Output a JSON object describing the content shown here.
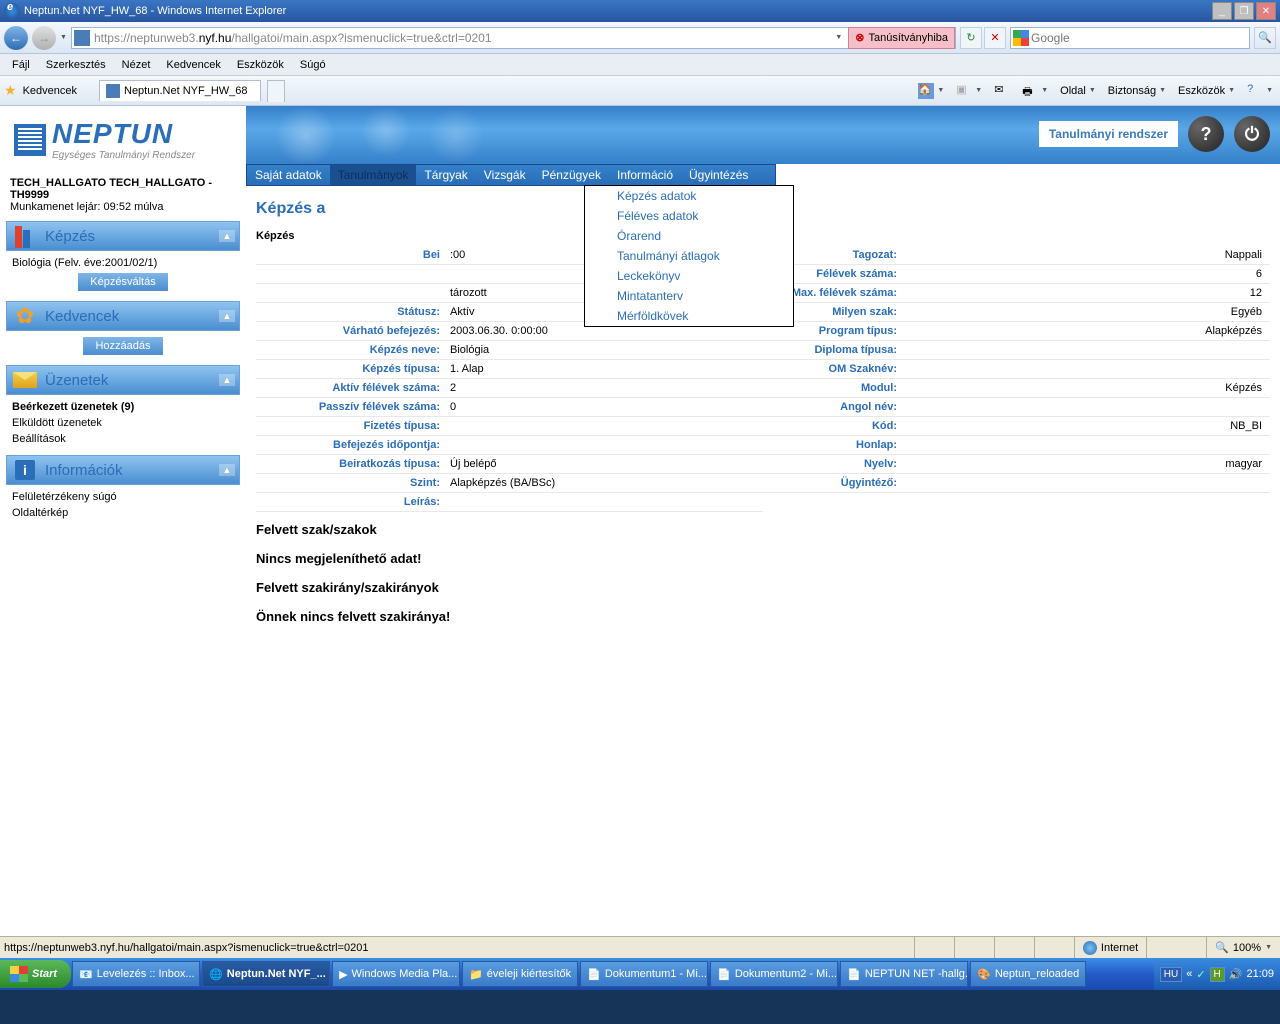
{
  "window": {
    "title": "Neptun.Net NYF_HW_68 - Windows Internet Explorer",
    "minimize": "_",
    "maximize": "❐",
    "close": "✕"
  },
  "nav": {
    "url_pre": "https://neptunweb3.",
    "url_green": "nyf.hu",
    "url_post": "/hallgatoi/main.aspx?ismenuclick=true&ctrl=0201",
    "cert_error": "Tanúsítványhiba",
    "search_placeholder": "Google"
  },
  "menu": [
    "Fájl",
    "Szerkesztés",
    "Nézet",
    "Kedvencek",
    "Eszközök",
    "Súgó"
  ],
  "favbar": {
    "label": "Kedvencek",
    "tab": "Neptun.Net NYF_HW_68",
    "tools": [
      "Oldal",
      "Biztonság",
      "Eszközök"
    ]
  },
  "brand": {
    "name": "NEPTUN",
    "sub": "Egységes Tanulmányi Rendszer"
  },
  "user": {
    "name": "TECH_HALLGATO TECH_HALLGATO - TH9999",
    "session": "Munkamenet lejár: 09:52 múlva"
  },
  "sidebar": {
    "training": {
      "title": "Képzés",
      "current": "Biológia (Felv. éve:2001/02/1)",
      "switch_btn": "Képzésváltás"
    },
    "favorites": {
      "title": "Kedvencek",
      "add_btn": "Hozzáadás"
    },
    "messages": {
      "title": "Üzenetek",
      "items": [
        "Beérkezett üzenetek (9)",
        "Elküldött üzenetek",
        "Beállítások"
      ]
    },
    "info": {
      "title": "Információk",
      "items": [
        "Felületérzékeny súgó",
        "Oldaltérkép"
      ]
    }
  },
  "header": {
    "system": "Tanulmányi rendszer",
    "help": "?",
    "power": "⏻"
  },
  "mainmenu": [
    "Saját adatok",
    "Tanulmányok",
    "Tárgyak",
    "Vizsgák",
    "Pénzügyek",
    "Információ",
    "Ügyintézés"
  ],
  "dropdown": [
    "Képzés adatok",
    "Féléves adatok",
    "Órarend",
    "Tanulmányi átlagok",
    "Leckekönyv",
    "Mintatanterv",
    "Mérföldkövek"
  ],
  "page": {
    "title": "Képzés a",
    "section": "Képzés"
  },
  "left_fields": [
    {
      "l": "Bei",
      "v": ":00"
    },
    {
      "l": "",
      "v": ""
    },
    {
      "l": "",
      "v": "tározott"
    },
    {
      "l": "Státusz:",
      "v": "Aktív"
    },
    {
      "l": "Várható befejezés:",
      "v": "2003.06.30. 0:00:00"
    },
    {
      "l": "Képzés neve:",
      "v": "Biológia"
    },
    {
      "l": "Képzés típusa:",
      "v": "1. Alap"
    },
    {
      "l": "Aktív félévek száma:",
      "v": "2"
    },
    {
      "l": "Passzív félévek száma:",
      "v": "0"
    },
    {
      "l": "Fizetés típusa:",
      "v": ""
    },
    {
      "l": "Befejezés időpontja:",
      "v": ""
    },
    {
      "l": "Beiratkozás típusa:",
      "v": "Új belépő"
    },
    {
      "l": "Szint:",
      "v": "Alapképzés (BA/BSc)"
    },
    {
      "l": "Leírás:",
      "v": ""
    }
  ],
  "right_fields": [
    {
      "l": "Tagozat:",
      "v": "Nappali"
    },
    {
      "l": "Félévek száma:",
      "v": "6"
    },
    {
      "l": "Max. félévek száma:",
      "v": "12"
    },
    {
      "l": "Milyen szak:",
      "v": "Egyéb"
    },
    {
      "l": "Program típus:",
      "v": "Alapképzés"
    },
    {
      "l": "Diploma típusa:",
      "v": ""
    },
    {
      "l": "OM Szaknév:",
      "v": ""
    },
    {
      "l": "Modul:",
      "v": "Képzés"
    },
    {
      "l": "Angol név:",
      "v": ""
    },
    {
      "l": "Kód:",
      "v": "NB_BI"
    },
    {
      "l": "Honlap:",
      "v": ""
    },
    {
      "l": "Nyelv:",
      "v": "magyar"
    },
    {
      "l": "Ügyintéző:",
      "v": ""
    }
  ],
  "sections": [
    "Felvett szak/szakok",
    "Nincs megjeleníthető adat!",
    "Felvett szakirány/szakirányok",
    "Önnek nincs felvett szakiránya!"
  ],
  "status": {
    "text": "https://neptunweb3.nyf.hu/hallgatoi/main.aspx?ismenuclick=true&ctrl=0201",
    "zone": "Internet",
    "zoom": "100%"
  },
  "taskbar": {
    "start": "Start",
    "items": [
      "Levelezés :: Inbox...",
      "Neptun.Net NYF_...",
      "Windows Media Pla...",
      "éveleji kiértesítők",
      "Dokumentum1 - Mi...",
      "Dokumentum2 - Mi...",
      "NEPTUN NET -hallg...",
      "Neptun_reloaded"
    ],
    "lang": "HU",
    "time": "21:09"
  }
}
